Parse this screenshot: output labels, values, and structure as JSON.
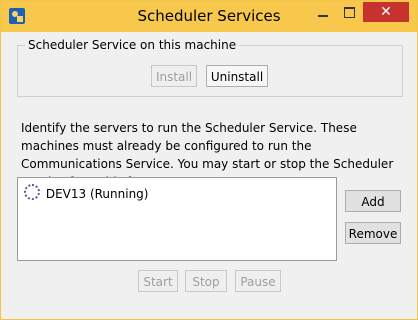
{
  "window": {
    "title": "Scheduler Services"
  },
  "titlebar": {
    "close": "✕"
  },
  "group": {
    "label": "Scheduler Service on this machine",
    "install": "Install",
    "uninstall": "Uninstall"
  },
  "description": "Identify the servers to run the Scheduler Service. These machines must already be configured to run the Communications Service. You may start or stop the Scheduler Service from this form.",
  "servers": [
    {
      "label": "DEV13 (Running)"
    }
  ],
  "actions": {
    "add": "Add",
    "remove": "Remove"
  },
  "bottom": {
    "start": "Start",
    "stop": "Stop",
    "pause": "Pause"
  }
}
